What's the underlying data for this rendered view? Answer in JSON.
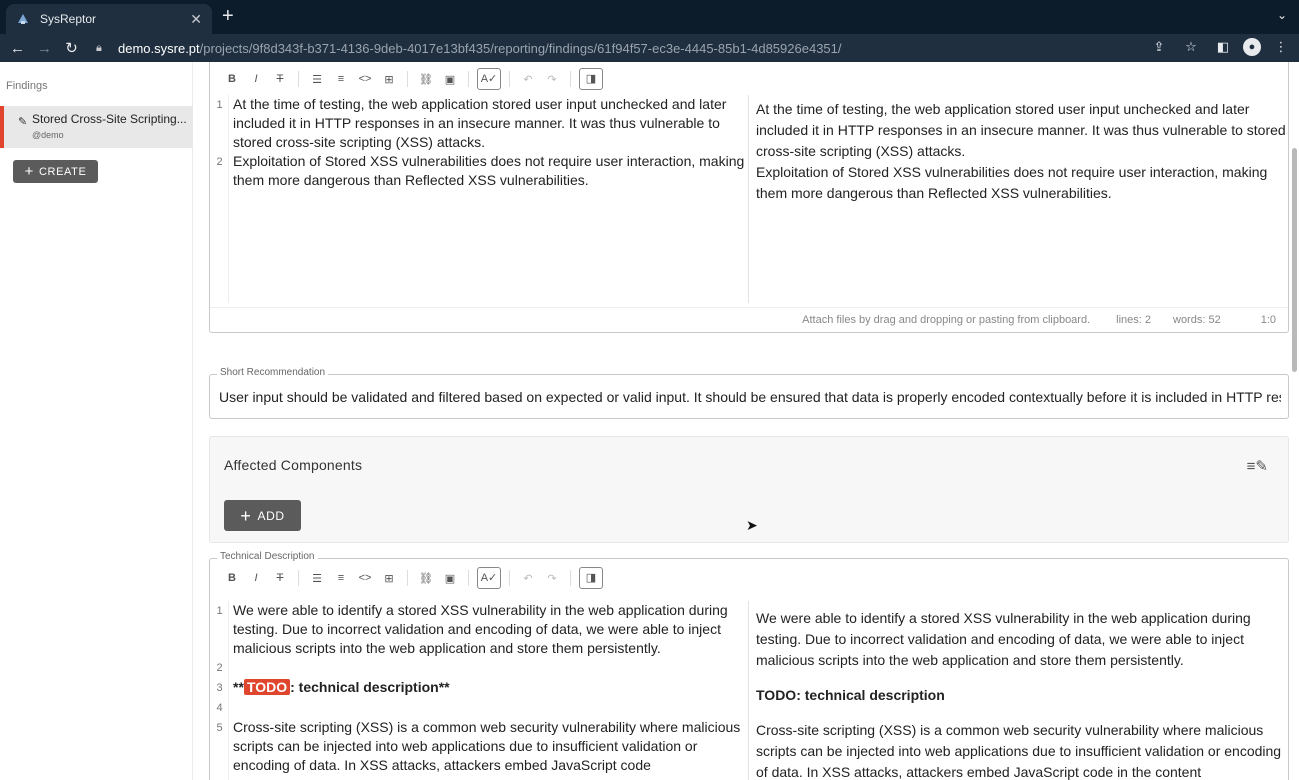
{
  "browser": {
    "tab_title": "SysReptor",
    "tab_close": "✕",
    "new_tab": "+",
    "tab_menu": "⌄",
    "url_host": "demo.sysre.pt",
    "url_path": "/projects/9f8d343f-b371-4136-9deb-4017e13bf435/reporting/findings/61f94f57-ec3e-4445-85b1-4d85926e4351/",
    "icons": {
      "back": "arrow-left-icon",
      "forward": "arrow-right-icon",
      "reload": "reload-icon",
      "lock": "lock-icon",
      "share": "share-icon",
      "star": "star-icon",
      "sidepanel": "side-panel-icon",
      "profile": "profile-icon",
      "menu": "kebab-menu-icon"
    }
  },
  "sidebar": {
    "section_title": "Findings",
    "findings": [
      {
        "title": "Stored Cross-Site Scripting...",
        "subtitle": "@demo"
      }
    ],
    "create_label": "CREATE"
  },
  "description": {
    "lines": [
      {
        "num": "1",
        "text": "At the time of testing, the web application stored user input unchecked and later included it in HTTP responses in an insecure manner. It was thus vulnerable to stored cross-site scripting (XSS) attacks."
      },
      {
        "num": "2",
        "text": "Exploitation of Stored XSS vulnerabilities does not require user interaction, making them more dangerous than Reflected XSS vulnerabilities."
      }
    ],
    "preview": [
      "At the time of testing, the web application stored user input unchecked and later included it in HTTP responses in an insecure manner. It was thus vulnerable to stored cross-site scripting (XSS) attacks.",
      "Exploitation of Stored XSS vulnerabilities does not require user interaction, making them more dangerous than Reflected XSS vulnerabilities."
    ],
    "status": {
      "hint": "Attach files by drag and dropping or pasting from clipboard.",
      "lines": "lines: 2",
      "words": "words: 52",
      "pos": "1:0"
    }
  },
  "short_recommendation": {
    "label": "Short Recommendation",
    "value": "User input should be validated and filtered based on expected or valid input. It should be ensured that data is properly encoded contextually before it is included in HTTP responses."
  },
  "affected_components": {
    "title": "Affected Components",
    "add_label": "ADD"
  },
  "technical_description": {
    "label": "Technical Description",
    "lines": [
      {
        "num": "1",
        "text": "We were able to identify a stored XSS vulnerability in the web application during testing. Due to incorrect validation and encoding of data, we were able to inject malicious scripts into the web application and store them persistently."
      },
      {
        "num": "2",
        "text": ""
      },
      {
        "num": "3",
        "pre": "**",
        "todo": "TODO",
        "post": ": technical description**"
      },
      {
        "num": "4",
        "text": ""
      },
      {
        "num": "5",
        "text": "Cross-site scripting (XSS) is a common web security vulnerability where malicious scripts can be injected into web applications due to insufficient validation or encoding of data. In XSS attacks, attackers embed JavaScript code"
      }
    ],
    "preview": {
      "p1": "We were able to identify a stored XSS vulnerability in the web application during testing. Due to incorrect validation and encoding of data, we were able to inject malicious scripts into the web application and store them persistently.",
      "heading": "TODO: technical description",
      "p2": "Cross-site scripting (XSS) is a common web security vulnerability where malicious scripts can be injected into web applications due to insufficient validation or encoding of data. In XSS attacks, attackers embed JavaScript code in the content"
    }
  },
  "toolbar_buttons": [
    "B",
    "I",
    "S",
    "ul",
    "ol",
    "code",
    "table",
    "link",
    "image",
    "spellcheck",
    "undo",
    "redo",
    "preview-toggle"
  ]
}
